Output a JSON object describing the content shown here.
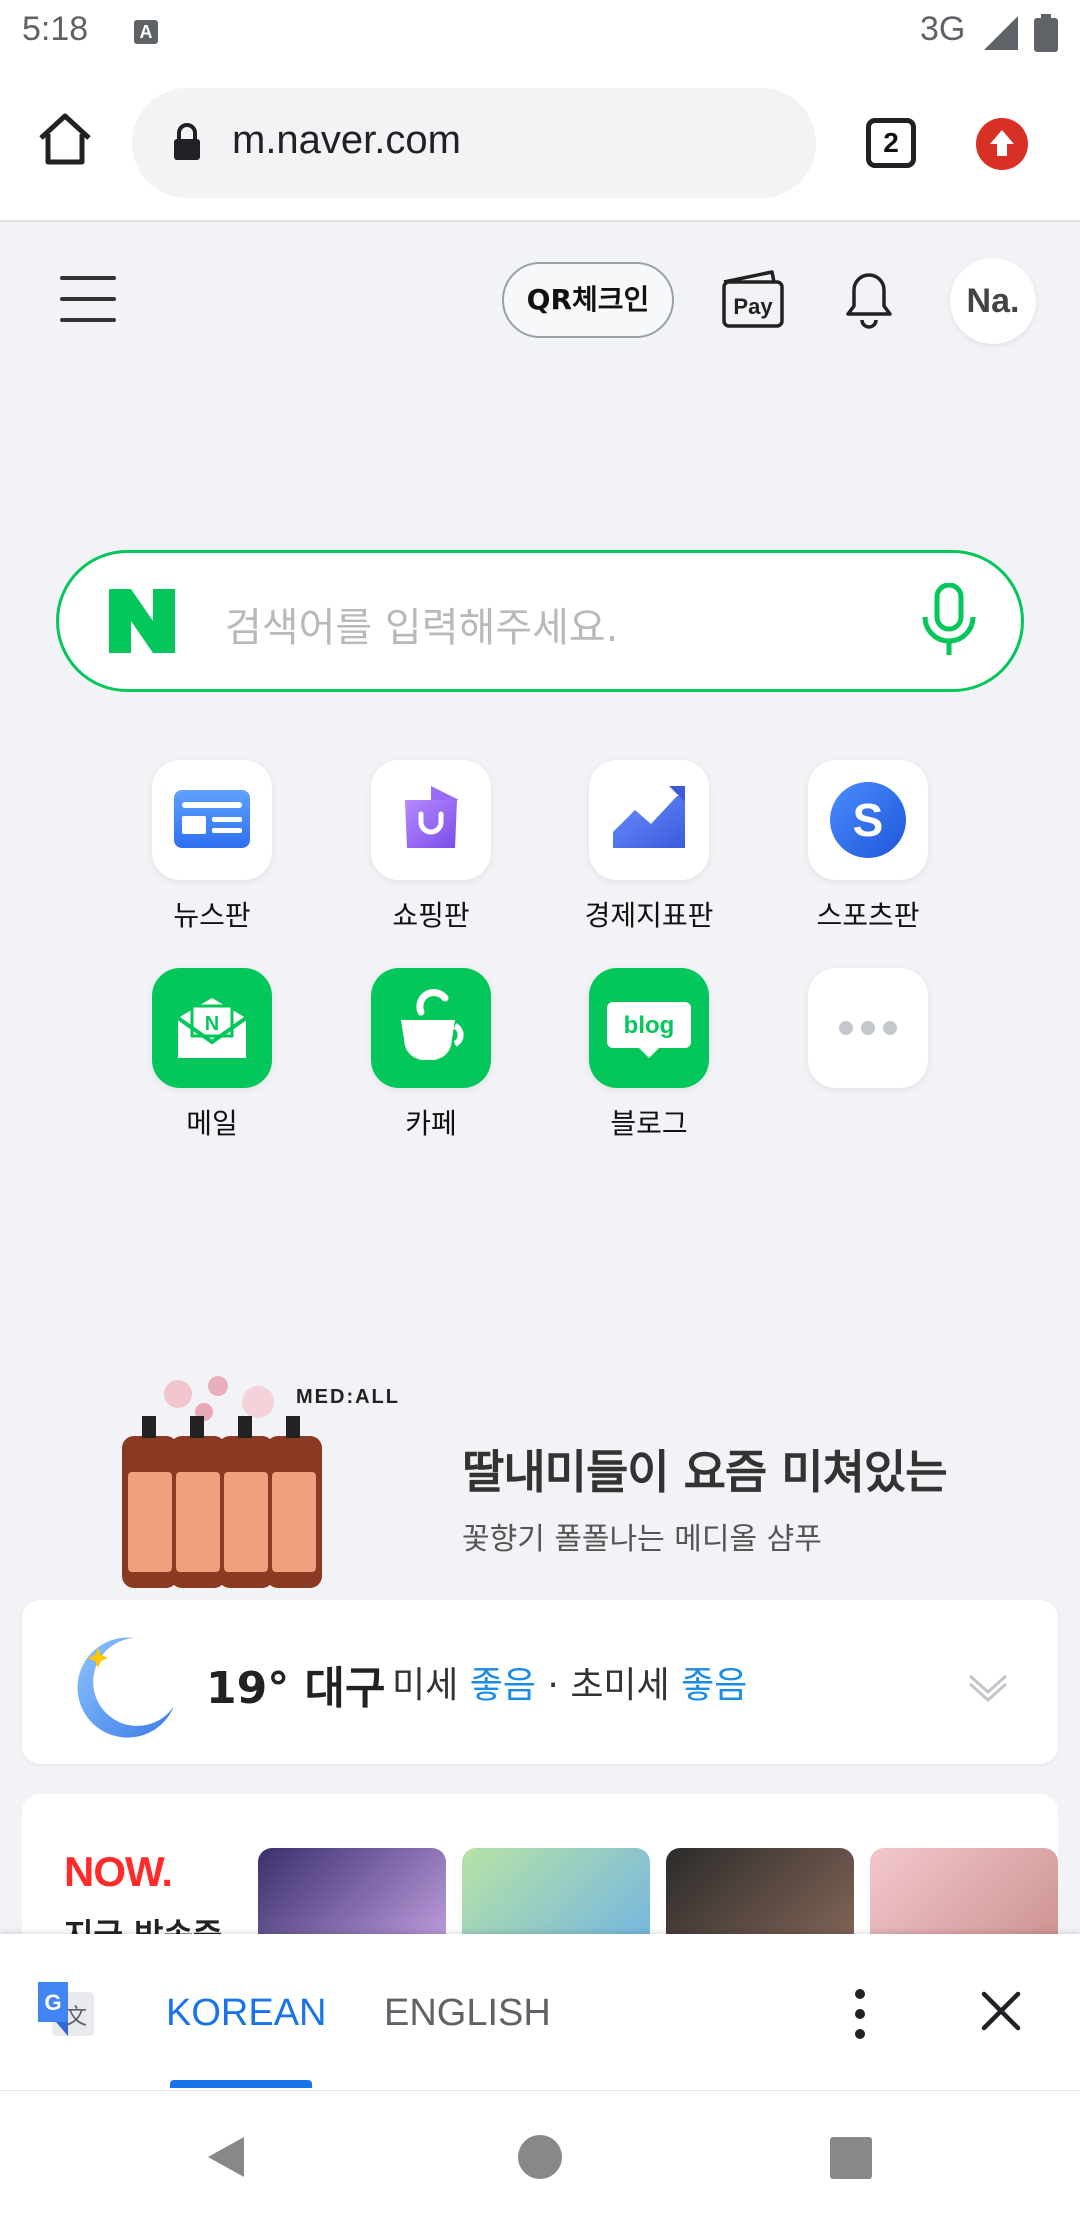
{
  "status_bar": {
    "time": "5:18",
    "notification_icon": "A",
    "network": "3G"
  },
  "browser": {
    "url": "m.naver.com",
    "tab_count": "2"
  },
  "header": {
    "qr_label": "QR체크인",
    "pay_label": "Pay",
    "avatar_label": "Na."
  },
  "search": {
    "placeholder": "검색어를 입력해주세요."
  },
  "shortcuts": [
    {
      "label": "뉴스판",
      "icon": "news-icon"
    },
    {
      "label": "쇼핑판",
      "icon": "shopping-bag-icon"
    },
    {
      "label": "경제지표판",
      "icon": "chart-icon"
    },
    {
      "label": "스포츠판",
      "icon": "sports-icon"
    },
    {
      "label": "메일",
      "icon": "mail-icon"
    },
    {
      "label": "카페",
      "icon": "cafe-icon"
    },
    {
      "label": "블로그",
      "icon": "blog-icon"
    },
    {
      "label": "",
      "icon": "more-icon"
    }
  ],
  "blog_icon_text": "blog",
  "ad": {
    "brand": "MED:ALL",
    "title": "딸내미들이 요즘 미쳐있는",
    "subtitle": "꽃향기 폴폴나는 메디올 샴푸"
  },
  "weather": {
    "temp_city": "19° 대구",
    "fine_dust_label": "미세",
    "fine_dust_value": "좋음",
    "separator": "·",
    "ultrafine_label": "초미세",
    "ultrafine_value": "좋음"
  },
  "now": {
    "logo": "NOW.",
    "subtitle": "지금 방송중"
  },
  "translate": {
    "tab_korean": "KOREAN",
    "tab_english": "ENGLISH"
  },
  "colors": {
    "naver_green": "#03c75a",
    "accent_blue": "#1a73e8",
    "good_blue": "#1b8ce6",
    "now_red": "#ff2a2a"
  }
}
